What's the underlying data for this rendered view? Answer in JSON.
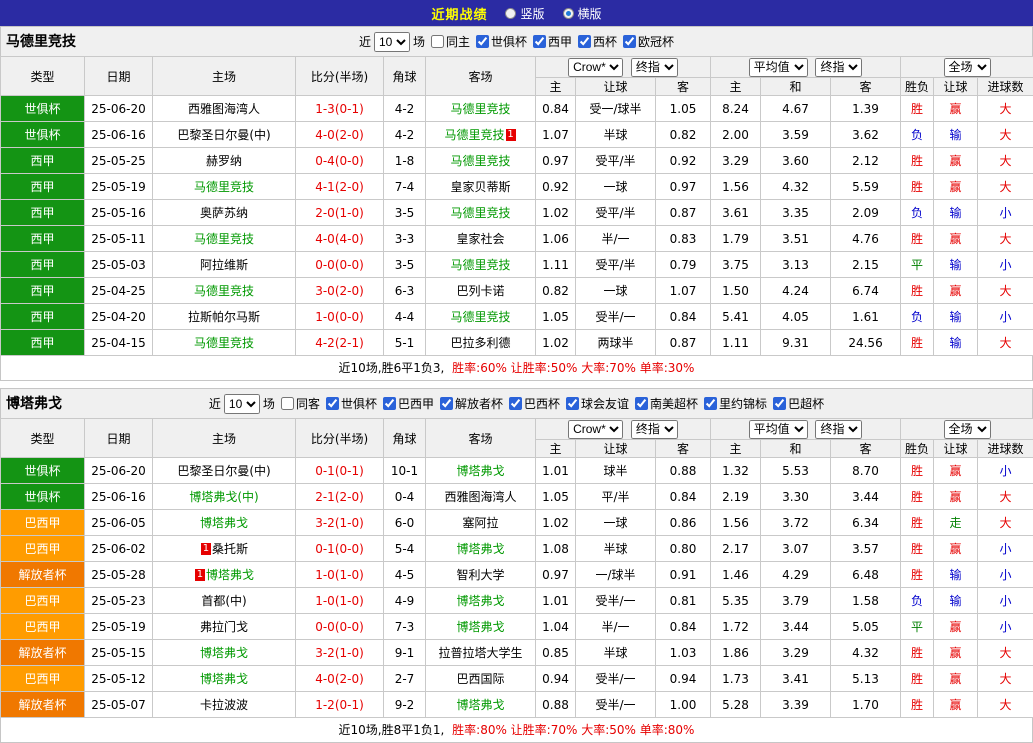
{
  "topbar": {
    "title": "近期战绩",
    "options": [
      {
        "label": "竖版",
        "selected": false
      },
      {
        "label": "横版",
        "selected": true
      }
    ]
  },
  "filter_labels": {
    "near": "近",
    "games": "场"
  },
  "dropdowns": {
    "asian_source": "Crow*",
    "asian_time": "终指",
    "euro_source": "平均值",
    "euro_time": "终指",
    "scope": "全场"
  },
  "table_headers": {
    "type": "类型",
    "date": "日期",
    "home": "主场",
    "score": "比分(半场)",
    "corner": "角球",
    "away": "客场",
    "asian": [
      "主",
      "让球",
      "客"
    ],
    "euro": [
      "主",
      "和",
      "客"
    ],
    "result": [
      "胜负",
      "让球",
      "进球数"
    ]
  },
  "type_colors": {
    "世俱杯": "#149414",
    "西甲": "#149414",
    "巴西甲": "#ff9c00",
    "解放者杯": "#f07800"
  },
  "result_colors": {
    "胜": "#e60000",
    "平": "#008000",
    "负": "#0000cc",
    "赢": "#e60000",
    "走": "#008000",
    "输": "#0000cc",
    "大": "#e60000",
    "小": "#0000cc"
  },
  "accent_colors": {
    "focus_team": "#009900",
    "score": "#e60000",
    "red_card_badge": "#e60000",
    "topbar_bg": "#2b2ba3",
    "topbar_title": "#ffff00"
  },
  "sections": [
    {
      "team": "马德里竞技",
      "filter": {
        "count": "10",
        "same_side": "同主",
        "competitions": [
          "世俱杯",
          "西甲",
          "西杯",
          "欧冠杯"
        ]
      },
      "rows": [
        {
          "type": "世俱杯",
          "date": "25-06-20",
          "home": "西雅图海湾人",
          "score": "1-3(0-1)",
          "corner": "4-2",
          "away": "马德里竞技",
          "away_focus": true,
          "ah": [
            "0.84",
            "受一/球半",
            "1.05"
          ],
          "eu": [
            "8.24",
            "4.67",
            "1.39"
          ],
          "res": [
            "胜",
            "赢",
            "大"
          ]
        },
        {
          "type": "世俱杯",
          "date": "25-06-16",
          "home": "巴黎圣日尔曼(中)",
          "score": "4-0(2-0)",
          "corner": "4-2",
          "away": "马德里竞技",
          "away_focus": true,
          "away_red": "1",
          "ah": [
            "1.07",
            "半球",
            "0.82"
          ],
          "eu": [
            "2.00",
            "3.59",
            "3.62"
          ],
          "res": [
            "负",
            "输",
            "大"
          ]
        },
        {
          "type": "西甲",
          "date": "25-05-25",
          "home": "赫罗纳",
          "score": "0-4(0-0)",
          "corner": "1-8",
          "away": "马德里竞技",
          "away_focus": true,
          "ah": [
            "0.97",
            "受平/半",
            "0.92"
          ],
          "eu": [
            "3.29",
            "3.60",
            "2.12"
          ],
          "res": [
            "胜",
            "赢",
            "大"
          ]
        },
        {
          "type": "西甲",
          "date": "25-05-19",
          "home": "马德里竞技",
          "home_focus": true,
          "score": "4-1(2-0)",
          "corner": "7-4",
          "away": "皇家贝蒂斯",
          "ah": [
            "0.92",
            "一球",
            "0.97"
          ],
          "eu": [
            "1.56",
            "4.32",
            "5.59"
          ],
          "res": [
            "胜",
            "赢",
            "大"
          ]
        },
        {
          "type": "西甲",
          "date": "25-05-16",
          "home": "奥萨苏纳",
          "score": "2-0(1-0)",
          "corner": "3-5",
          "away": "马德里竞技",
          "away_focus": true,
          "ah": [
            "1.02",
            "受平/半",
            "0.87"
          ],
          "eu": [
            "3.61",
            "3.35",
            "2.09"
          ],
          "res": [
            "负",
            "输",
            "小"
          ]
        },
        {
          "type": "西甲",
          "date": "25-05-11",
          "home": "马德里竞技",
          "home_focus": true,
          "score": "4-0(4-0)",
          "corner": "3-3",
          "away": "皇家社会",
          "ah": [
            "1.06",
            "半/一",
            "0.83"
          ],
          "eu": [
            "1.79",
            "3.51",
            "4.76"
          ],
          "res": [
            "胜",
            "赢",
            "大"
          ]
        },
        {
          "type": "西甲",
          "date": "25-05-03",
          "home": "阿拉维斯",
          "score": "0-0(0-0)",
          "corner": "3-5",
          "away": "马德里竞技",
          "away_focus": true,
          "ah": [
            "1.11",
            "受平/半",
            "0.79"
          ],
          "eu": [
            "3.75",
            "3.13",
            "2.15"
          ],
          "res": [
            "平",
            "输",
            "小"
          ]
        },
        {
          "type": "西甲",
          "date": "25-04-25",
          "home": "马德里竞技",
          "home_focus": true,
          "score": "3-0(2-0)",
          "corner": "6-3",
          "away": "巴列卡诺",
          "ah": [
            "0.82",
            "一球",
            "1.07"
          ],
          "eu": [
            "1.50",
            "4.24",
            "6.74"
          ],
          "res": [
            "胜",
            "赢",
            "大"
          ]
        },
        {
          "type": "西甲",
          "date": "25-04-20",
          "home": "拉斯帕尔马斯",
          "score": "1-0(0-0)",
          "corner": "4-4",
          "away": "马德里竞技",
          "away_focus": true,
          "ah": [
            "1.05",
            "受半/一",
            "0.84"
          ],
          "eu": [
            "5.41",
            "4.05",
            "1.61"
          ],
          "res": [
            "负",
            "输",
            "小"
          ]
        },
        {
          "type": "西甲",
          "date": "25-04-15",
          "home": "马德里竞技",
          "home_focus": true,
          "score": "4-2(2-1)",
          "corner": "5-1",
          "away": "巴拉多利德",
          "ah": [
            "1.02",
            "两球半",
            "0.87"
          ],
          "eu": [
            "1.11",
            "9.31",
            "24.56"
          ],
          "res": [
            "胜",
            "输",
            "大"
          ]
        }
      ],
      "summary": {
        "record": "近10场,胜6平1负3,",
        "rates": "胜率:60% 让胜率:50% 大率:70% 单率:30%"
      }
    },
    {
      "team": "博塔弗戈",
      "filter": {
        "count": "10",
        "same_side": "同客",
        "competitions": [
          "世俱杯",
          "巴西甲",
          "解放者杯",
          "巴西杯",
          "球会友谊",
          "南美超杯",
          "里约锦标",
          "巴超杯"
        ]
      },
      "rows": [
        {
          "type": "世俱杯",
          "date": "25-06-20",
          "home": "巴黎圣日尔曼(中)",
          "score": "0-1(0-1)",
          "corner": "10-1",
          "away": "博塔弗戈",
          "away_focus": true,
          "ah": [
            "1.01",
            "球半",
            "0.88"
          ],
          "eu": [
            "1.32",
            "5.53",
            "8.70"
          ],
          "res": [
            "胜",
            "赢",
            "小"
          ]
        },
        {
          "type": "世俱杯",
          "date": "25-06-16",
          "home": "博塔弗戈(中)",
          "home_focus": true,
          "score": "2-1(2-0)",
          "corner": "0-4",
          "away": "西雅图海湾人",
          "ah": [
            "1.05",
            "平/半",
            "0.84"
          ],
          "eu": [
            "2.19",
            "3.30",
            "3.44"
          ],
          "res": [
            "胜",
            "赢",
            "大"
          ]
        },
        {
          "type": "巴西甲",
          "date": "25-06-05",
          "home": "博塔弗戈",
          "home_focus": true,
          "score": "3-2(1-0)",
          "corner": "6-0",
          "away": "塞阿拉",
          "ah": [
            "1.02",
            "一球",
            "0.86"
          ],
          "eu": [
            "1.56",
            "3.72",
            "6.34"
          ],
          "res": [
            "胜",
            "走",
            "大"
          ]
        },
        {
          "type": "巴西甲",
          "date": "25-06-02",
          "home": "桑托斯",
          "home_red": "1",
          "score": "0-1(0-0)",
          "corner": "5-4",
          "away": "博塔弗戈",
          "away_focus": true,
          "ah": [
            "1.08",
            "半球",
            "0.80"
          ],
          "eu": [
            "2.17",
            "3.07",
            "3.57"
          ],
          "res": [
            "胜",
            "赢",
            "小"
          ]
        },
        {
          "type": "解放者杯",
          "date": "25-05-28",
          "home": "博塔弗戈",
          "home_focus": true,
          "home_red": "1",
          "score": "1-0(1-0)",
          "corner": "4-5",
          "away": "智利大学",
          "ah": [
            "0.97",
            "一/球半",
            "0.91"
          ],
          "eu": [
            "1.46",
            "4.29",
            "6.48"
          ],
          "res": [
            "胜",
            "输",
            "小"
          ]
        },
        {
          "type": "巴西甲",
          "date": "25-05-23",
          "home": "首都(中)",
          "score": "1-0(1-0)",
          "corner": "4-9",
          "away": "博塔弗戈",
          "away_focus": true,
          "ah": [
            "1.01",
            "受半/一",
            "0.81"
          ],
          "eu": [
            "5.35",
            "3.79",
            "1.58"
          ],
          "res": [
            "负",
            "输",
            "小"
          ]
        },
        {
          "type": "巴西甲",
          "date": "25-05-19",
          "home": "弗拉门戈",
          "score": "0-0(0-0)",
          "corner": "7-3",
          "away": "博塔弗戈",
          "away_focus": true,
          "ah": [
            "1.04",
            "半/一",
            "0.84"
          ],
          "eu": [
            "1.72",
            "3.44",
            "5.05"
          ],
          "res": [
            "平",
            "赢",
            "小"
          ]
        },
        {
          "type": "解放者杯",
          "date": "25-05-15",
          "home": "博塔弗戈",
          "home_focus": true,
          "score": "3-2(1-0)",
          "corner": "9-1",
          "away": "拉普拉塔大学生",
          "ah": [
            "0.85",
            "半球",
            "1.03"
          ],
          "eu": [
            "1.86",
            "3.29",
            "4.32"
          ],
          "res": [
            "胜",
            "赢",
            "大"
          ]
        },
        {
          "type": "巴西甲",
          "date": "25-05-12",
          "home": "博塔弗戈",
          "home_focus": true,
          "score": "4-0(2-0)",
          "corner": "2-7",
          "away": "巴西国际",
          "ah": [
            "0.94",
            "受半/一",
            "0.94"
          ],
          "eu": [
            "1.73",
            "3.41",
            "5.13"
          ],
          "res": [
            "胜",
            "赢",
            "大"
          ]
        },
        {
          "type": "解放者杯",
          "date": "25-05-07",
          "home": "卡拉波波",
          "score": "1-2(0-1)",
          "corner": "9-2",
          "away": "博塔弗戈",
          "away_focus": true,
          "ah": [
            "0.88",
            "受半/一",
            "1.00"
          ],
          "eu": [
            "5.28",
            "3.39",
            "1.70"
          ],
          "res": [
            "胜",
            "赢",
            "大"
          ]
        }
      ],
      "summary": {
        "record": "近10场,胜8平1负1,",
        "rates": "胜率:80% 让胜率:70% 大率:50% 单率:80%"
      }
    }
  ]
}
